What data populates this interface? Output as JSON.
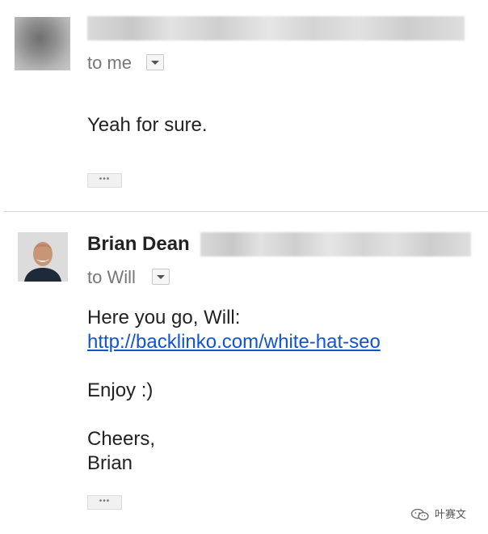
{
  "message1": {
    "recipient": "to me",
    "body": "Yeah for sure.",
    "ellipsis": "•••"
  },
  "message2": {
    "sender_name": "Brian Dean",
    "recipient": "to Will",
    "line1": "Here you go, Will:",
    "link": "http://backlinko.com/white-hat-seo",
    "line2": "Enjoy :)",
    "line3": "Cheers,",
    "line4": "Brian",
    "ellipsis": "•••"
  },
  "watermark": {
    "label": "叶赛文",
    "icon": "wechat-icon"
  }
}
